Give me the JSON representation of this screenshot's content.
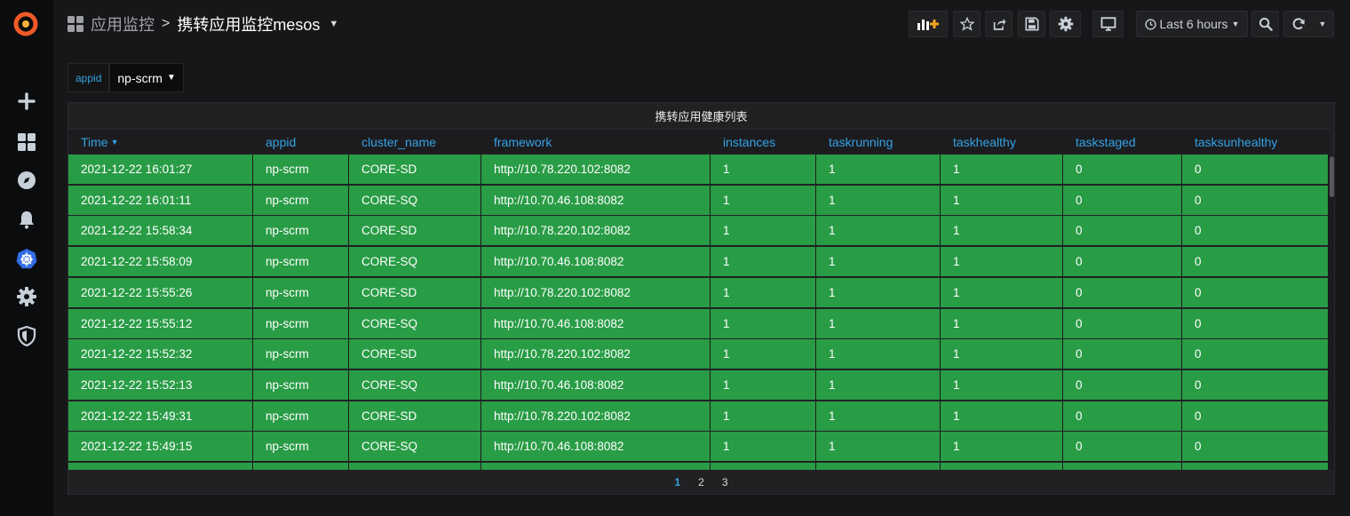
{
  "header": {
    "breadcrumb_parent": "应用监控",
    "breadcrumb_separator": ">",
    "dashboard_title": "携转应用监控mesos",
    "time_range": "Last 6 hours"
  },
  "variables": [
    {
      "label": "appid",
      "value": "np-scrm"
    }
  ],
  "panel": {
    "title": "携转应用健康列表",
    "columns": [
      "Time",
      "appid",
      "cluster_name",
      "framework",
      "instances",
      "taskrunning",
      "taskhealthy",
      "taskstaged",
      "tasksunhealthy"
    ],
    "rows": [
      [
        "2021-12-22 16:01:27",
        "np-scrm",
        "CORE-SD",
        "http://10.78.220.102:8082",
        "1",
        "1",
        "1",
        "0",
        "0"
      ],
      [
        "2021-12-22 16:01:11",
        "np-scrm",
        "CORE-SQ",
        "http://10.70.46.108:8082",
        "1",
        "1",
        "1",
        "0",
        "0"
      ],
      [
        "2021-12-22 15:58:34",
        "np-scrm",
        "CORE-SD",
        "http://10.78.220.102:8082",
        "1",
        "1",
        "1",
        "0",
        "0"
      ],
      [
        "2021-12-22 15:58:09",
        "np-scrm",
        "CORE-SQ",
        "http://10.70.46.108:8082",
        "1",
        "1",
        "1",
        "0",
        "0"
      ],
      [
        "2021-12-22 15:55:26",
        "np-scrm",
        "CORE-SD",
        "http://10.78.220.102:8082",
        "1",
        "1",
        "1",
        "0",
        "0"
      ],
      [
        "2021-12-22 15:55:12",
        "np-scrm",
        "CORE-SQ",
        "http://10.70.46.108:8082",
        "1",
        "1",
        "1",
        "0",
        "0"
      ],
      [
        "2021-12-22 15:52:32",
        "np-scrm",
        "CORE-SD",
        "http://10.78.220.102:8082",
        "1",
        "1",
        "1",
        "0",
        "0"
      ],
      [
        "2021-12-22 15:52:13",
        "np-scrm",
        "CORE-SQ",
        "http://10.70.46.108:8082",
        "1",
        "1",
        "1",
        "0",
        "0"
      ],
      [
        "2021-12-22 15:49:31",
        "np-scrm",
        "CORE-SD",
        "http://10.78.220.102:8082",
        "1",
        "1",
        "1",
        "0",
        "0"
      ],
      [
        "2021-12-22 15:49:15",
        "np-scrm",
        "CORE-SQ",
        "http://10.70.46.108:8082",
        "1",
        "1",
        "1",
        "0",
        "0"
      ],
      [
        "",
        "",
        "",
        "",
        "",
        "",
        "",
        "",
        ""
      ]
    ],
    "pages": [
      "1",
      "2",
      "3"
    ],
    "active_page": "1"
  },
  "colors": {
    "cell_ok": "#299c46",
    "accent": "#33a2e5",
    "logo": "#f05a28"
  },
  "icons": {
    "sidebar": [
      "grafana-logo-icon",
      "plus-icon",
      "dashboards-icon",
      "explore-icon",
      "alerting-bell-icon",
      "kubernetes-icon",
      "gear-icon",
      "shield-icon"
    ],
    "toolbar": [
      "add-panel-icon",
      "star-icon",
      "share-icon",
      "save-icon",
      "settings-icon",
      "tv-monitor-icon",
      "clock-icon",
      "zoom-out-icon",
      "refresh-icon",
      "chevron-down-icon"
    ]
  }
}
